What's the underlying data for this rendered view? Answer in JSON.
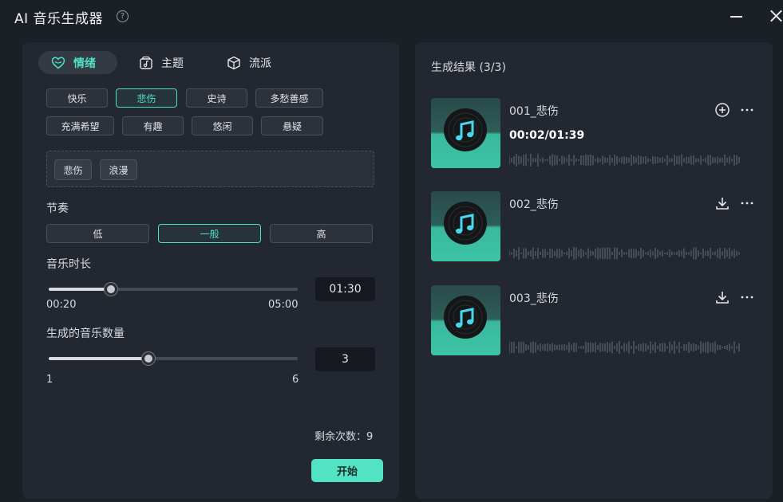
{
  "window": {
    "title": "AI 音乐生成器",
    "help_icon": "question-circle-icon",
    "help_glyph": "?"
  },
  "tabs": [
    {
      "label": "情绪",
      "icon": "heart-icon",
      "active": true
    },
    {
      "label": "主题",
      "icon": "music-note-box-icon",
      "active": false
    },
    {
      "label": "流派",
      "icon": "cube-icon",
      "active": false
    }
  ],
  "moods": [
    "快乐",
    "悲伤",
    "史诗",
    "多愁善感",
    "充满希望",
    "有趣",
    "悠闲",
    "悬疑"
  ],
  "selected_mood": "悲伤",
  "selected_tags": [
    "悲伤",
    "浪漫"
  ],
  "tempo": {
    "label": "节奏",
    "options": [
      "低",
      "一般",
      "高"
    ],
    "selected": "一般"
  },
  "duration": {
    "label": "音乐时长",
    "min_label": "00:20",
    "max_label": "05:00",
    "value": "01:30",
    "fraction": 0.25
  },
  "count": {
    "label": "生成的音乐数量",
    "min_label": "1",
    "max_label": "6",
    "value": "3",
    "fraction": 0.4
  },
  "remaining": "剩余次数：9",
  "start_label": "开始",
  "results": {
    "title": "生成结果 (3/3)",
    "items": [
      {
        "name": "001_悲伤",
        "time": "00:02/01:39",
        "action_icon": "plus-circle-icon",
        "more_icon": "more-icon"
      },
      {
        "name": "002_悲伤",
        "time": "",
        "action_icon": "download-icon",
        "more_icon": "more-icon"
      },
      {
        "name": "003_悲伤",
        "time": "",
        "action_icon": "download-icon",
        "more_icon": "more-icon"
      }
    ]
  },
  "colors": {
    "accent": "#4fe0c3",
    "background": "#1b1f26",
    "panel": "#232830"
  }
}
